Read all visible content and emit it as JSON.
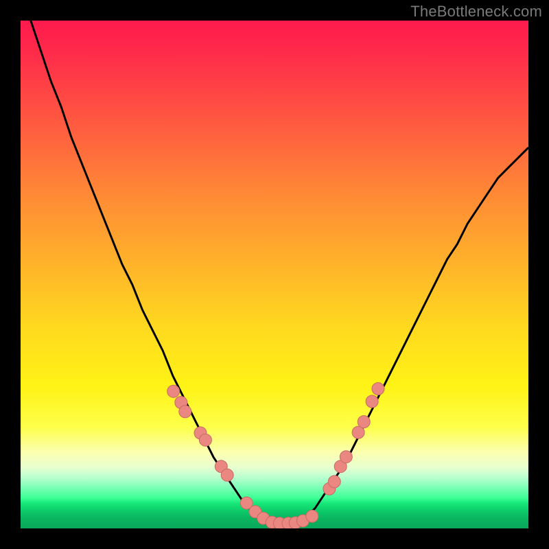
{
  "watermark": "TheBottleneck.com",
  "colors": {
    "bg": "#000000",
    "curve": "#000000",
    "dot_fill": "#e98780",
    "dot_stroke": "#c96a63"
  },
  "chart_data": {
    "type": "line",
    "title": "",
    "xlabel": "",
    "ylabel": "",
    "x": [
      0.0,
      0.02,
      0.04,
      0.06,
      0.08,
      0.1,
      0.12,
      0.14,
      0.16,
      0.18,
      0.2,
      0.22,
      0.24,
      0.26,
      0.28,
      0.3,
      0.32,
      0.34,
      0.36,
      0.38,
      0.4,
      0.42,
      0.44,
      0.46,
      0.48,
      0.5,
      0.52,
      0.54,
      0.56,
      0.58,
      0.6,
      0.62,
      0.64,
      0.66,
      0.68,
      0.7,
      0.72,
      0.74,
      0.76,
      0.78,
      0.8,
      0.82,
      0.84,
      0.86,
      0.88,
      0.9,
      0.92,
      0.94,
      0.96,
      0.98,
      1.0
    ],
    "values": [
      1.05,
      1.0,
      0.94,
      0.88,
      0.83,
      0.77,
      0.72,
      0.67,
      0.62,
      0.57,
      0.52,
      0.48,
      0.43,
      0.39,
      0.35,
      0.3,
      0.26,
      0.22,
      0.18,
      0.14,
      0.11,
      0.08,
      0.05,
      0.03,
      0.02,
      0.01,
      0.01,
      0.01,
      0.02,
      0.04,
      0.07,
      0.1,
      0.13,
      0.17,
      0.21,
      0.25,
      0.29,
      0.33,
      0.37,
      0.41,
      0.45,
      0.49,
      0.53,
      0.56,
      0.6,
      0.63,
      0.66,
      0.69,
      0.71,
      0.73,
      0.75
    ],
    "xlim": [
      0,
      1
    ],
    "ylim": [
      0,
      1
    ],
    "dots": [
      {
        "x": 0.301,
        "y": 0.27
      },
      {
        "x": 0.316,
        "y": 0.248
      },
      {
        "x": 0.324,
        "y": 0.23
      },
      {
        "x": 0.354,
        "y": 0.188
      },
      {
        "x": 0.364,
        "y": 0.174
      },
      {
        "x": 0.395,
        "y": 0.122
      },
      {
        "x": 0.407,
        "y": 0.105
      },
      {
        "x": 0.445,
        "y": 0.05
      },
      {
        "x": 0.462,
        "y": 0.033
      },
      {
        "x": 0.478,
        "y": 0.02
      },
      {
        "x": 0.495,
        "y": 0.012
      },
      {
        "x": 0.51,
        "y": 0.01
      },
      {
        "x": 0.527,
        "y": 0.01
      },
      {
        "x": 0.541,
        "y": 0.011
      },
      {
        "x": 0.556,
        "y": 0.015
      },
      {
        "x": 0.574,
        "y": 0.024
      },
      {
        "x": 0.608,
        "y": 0.078
      },
      {
        "x": 0.618,
        "y": 0.092
      },
      {
        "x": 0.63,
        "y": 0.122
      },
      {
        "x": 0.641,
        "y": 0.141
      },
      {
        "x": 0.665,
        "y": 0.189
      },
      {
        "x": 0.676,
        "y": 0.21
      },
      {
        "x": 0.692,
        "y": 0.25
      },
      {
        "x": 0.704,
        "y": 0.275
      }
    ]
  }
}
